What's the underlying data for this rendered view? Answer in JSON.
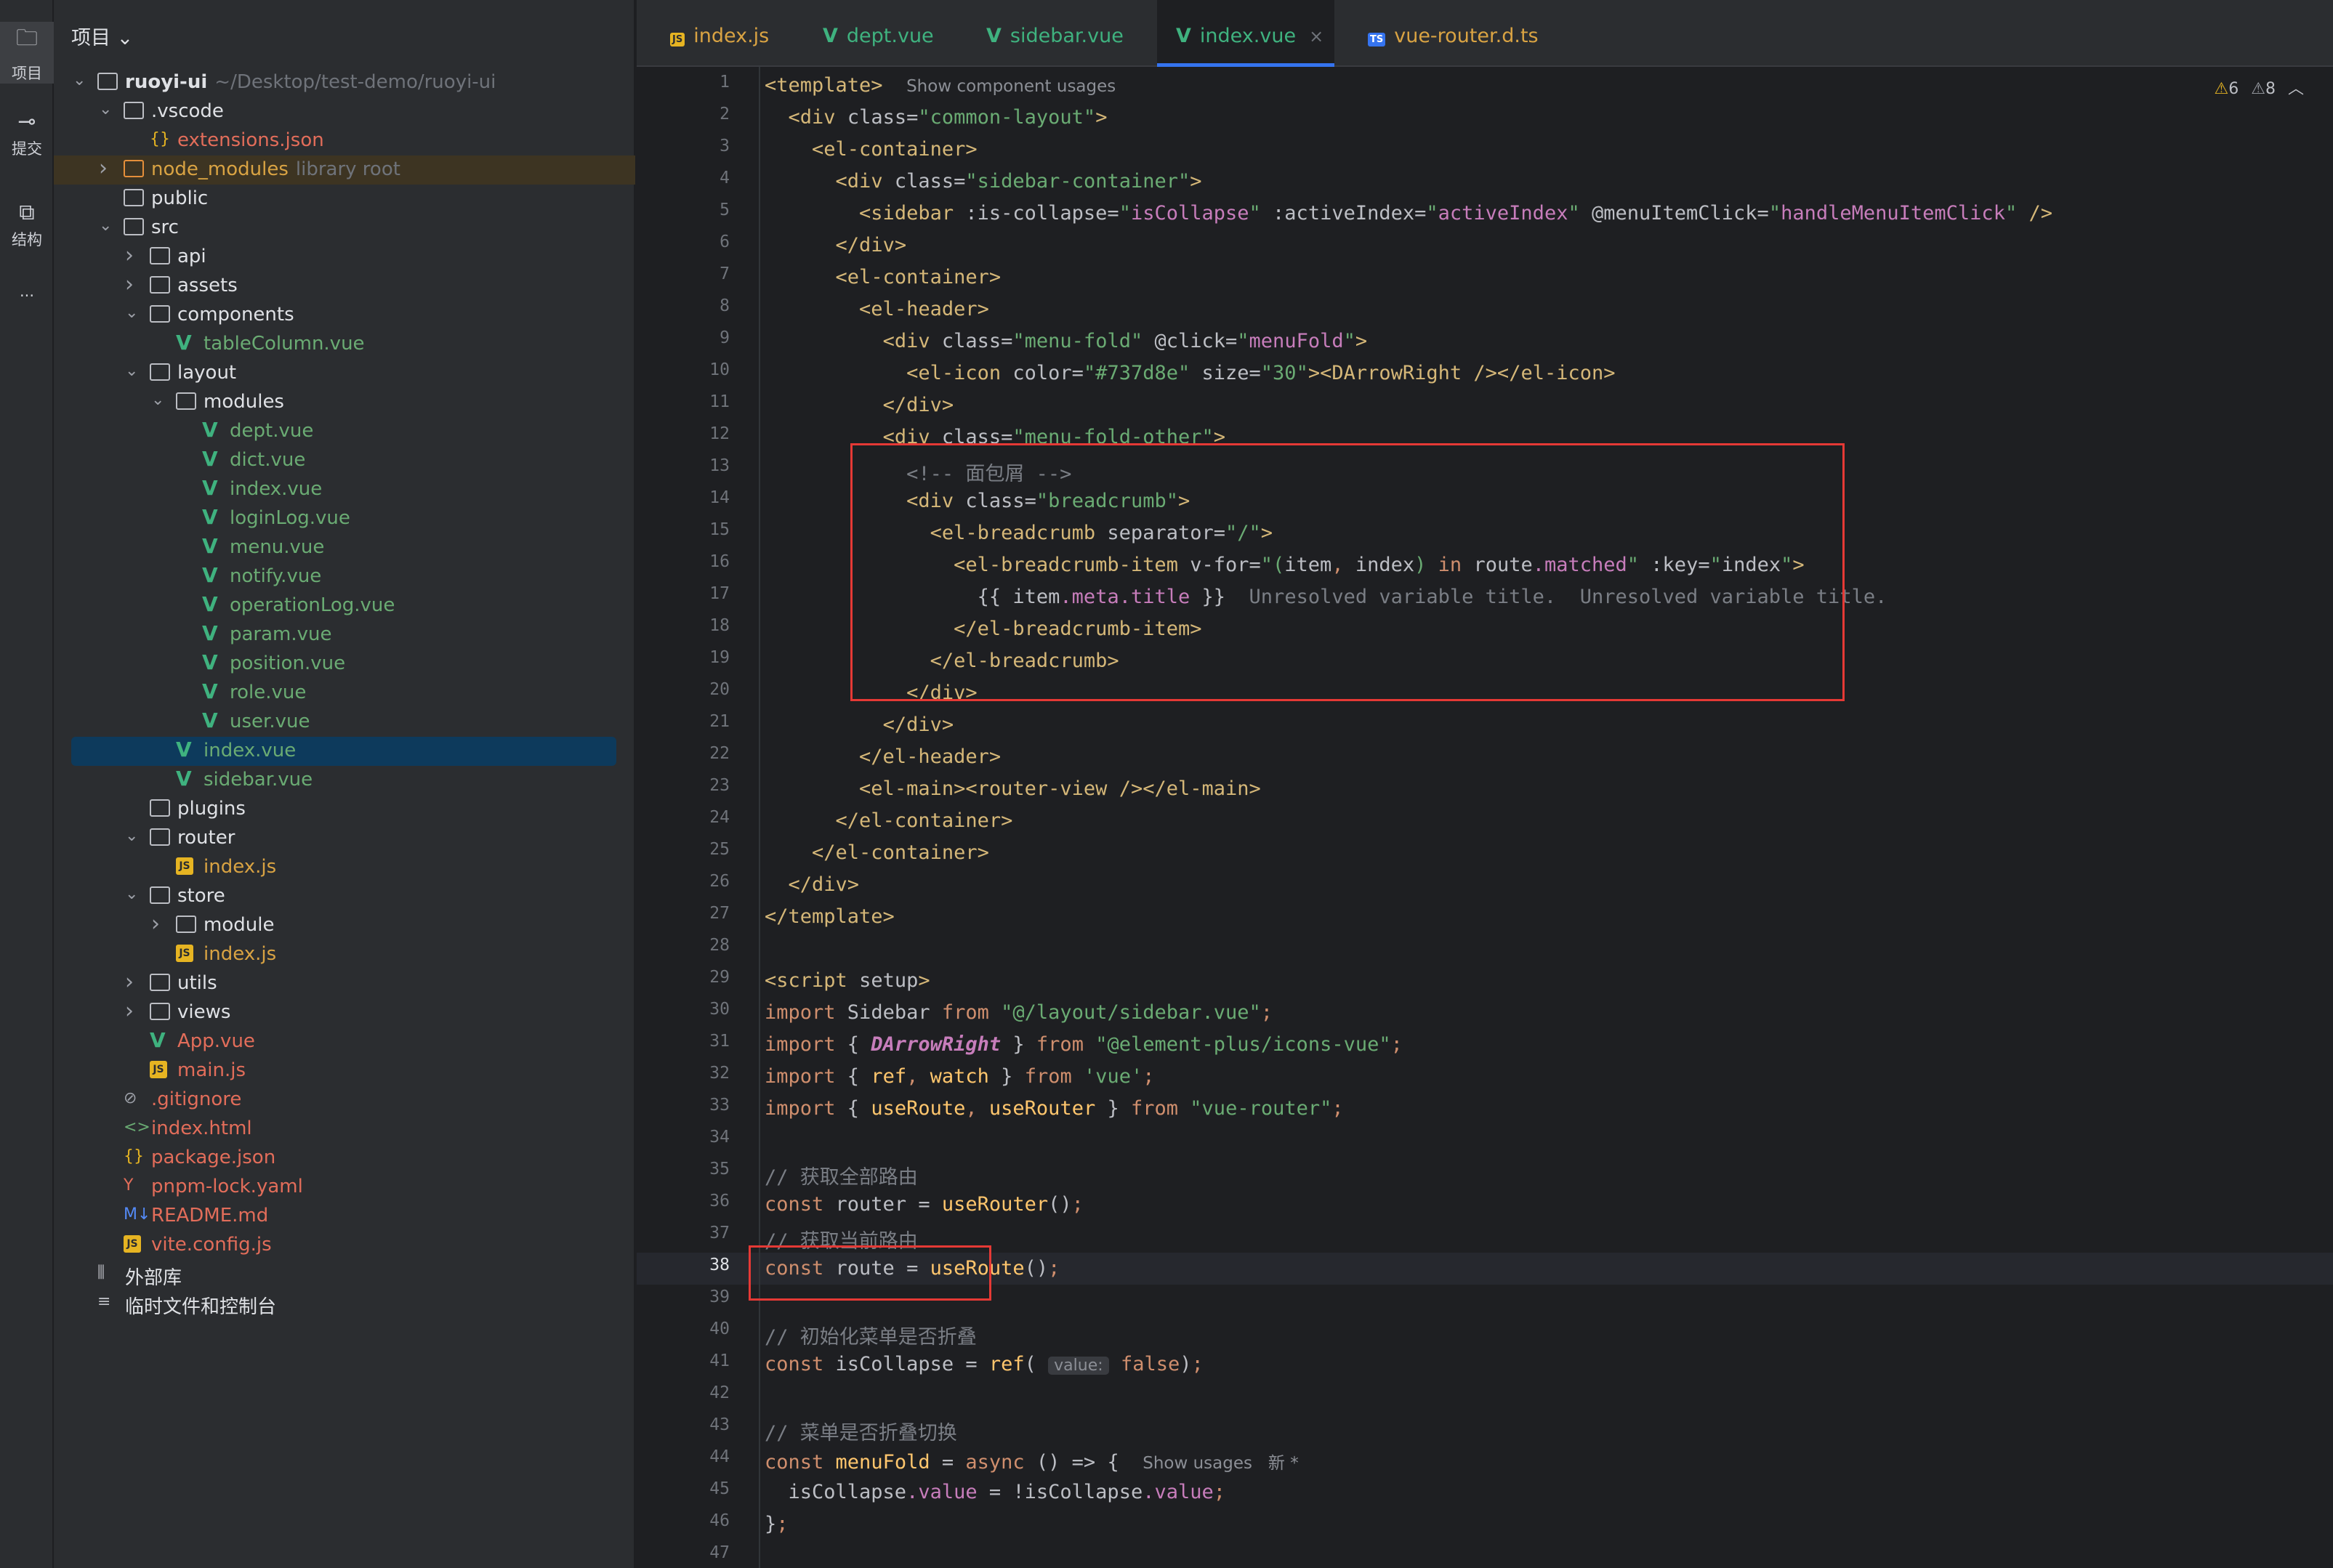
{
  "toolstrip": [
    {
      "label": "项目",
      "icon": "folder-icon"
    },
    {
      "label": "提交",
      "icon": "commit-icon"
    },
    {
      "label": "结构",
      "icon": "structure-icon"
    },
    {
      "label": "···",
      "icon": "more-icon"
    }
  ],
  "project": {
    "title": "项目",
    "tree": [
      {
        "label": "ruoyi-ui",
        "hint": "~/Desktop/test-demo/ruoyi-ui",
        "depth": 0,
        "arrow": "down",
        "icon": "folder",
        "color": "#dfe1e5",
        "bold": true
      },
      {
        "label": ".vscode",
        "depth": 1,
        "arrow": "down",
        "icon": "folder",
        "color": "#dfe1e5"
      },
      {
        "label": "extensions.json",
        "depth": 2,
        "icon": "json",
        "color": "#e26d5a"
      },
      {
        "label": "node_modules",
        "hint": "library root",
        "depth": 1,
        "arrow": "right",
        "icon": "folder-orange",
        "color": "#d9a343",
        "highlight": true
      },
      {
        "label": "public",
        "depth": 1,
        "icon": "folder",
        "color": "#dfe1e5"
      },
      {
        "label": "src",
        "depth": 1,
        "arrow": "down",
        "icon": "folder",
        "color": "#dfe1e5"
      },
      {
        "label": "api",
        "depth": 2,
        "arrow": "right",
        "icon": "folder",
        "color": "#dfe1e5"
      },
      {
        "label": "assets",
        "depth": 2,
        "arrow": "right",
        "icon": "folder",
        "color": "#dfe1e5"
      },
      {
        "label": "components",
        "depth": 2,
        "arrow": "down",
        "icon": "folder",
        "color": "#dfe1e5"
      },
      {
        "label": "tableColumn.vue",
        "depth": 3,
        "icon": "vue",
        "color": "#6aab73"
      },
      {
        "label": "layout",
        "depth": 2,
        "arrow": "down",
        "icon": "folder",
        "color": "#dfe1e5"
      },
      {
        "label": "modules",
        "depth": 3,
        "arrow": "down",
        "icon": "folder",
        "color": "#dfe1e5"
      },
      {
        "label": "dept.vue",
        "depth": 4,
        "icon": "vue",
        "color": "#6aab73"
      },
      {
        "label": "dict.vue",
        "depth": 4,
        "icon": "vue",
        "color": "#6aab73"
      },
      {
        "label": "index.vue",
        "depth": 4,
        "icon": "vue",
        "color": "#6aab73"
      },
      {
        "label": "loginLog.vue",
        "depth": 4,
        "icon": "vue",
        "color": "#6aab73"
      },
      {
        "label": "menu.vue",
        "depth": 4,
        "icon": "vue",
        "color": "#6aab73"
      },
      {
        "label": "notify.vue",
        "depth": 4,
        "icon": "vue",
        "color": "#6aab73"
      },
      {
        "label": "operationLog.vue",
        "depth": 4,
        "icon": "vue",
        "color": "#6aab73"
      },
      {
        "label": "param.vue",
        "depth": 4,
        "icon": "vue",
        "color": "#6aab73"
      },
      {
        "label": "position.vue",
        "depth": 4,
        "icon": "vue",
        "color": "#6aab73"
      },
      {
        "label": "role.vue",
        "depth": 4,
        "icon": "vue",
        "color": "#6aab73"
      },
      {
        "label": "user.vue",
        "depth": 4,
        "icon": "vue",
        "color": "#6aab73"
      },
      {
        "label": "index.vue",
        "depth": 3,
        "icon": "vue",
        "color": "#6aab73",
        "selected": true
      },
      {
        "label": "sidebar.vue",
        "depth": 3,
        "icon": "vue",
        "color": "#6aab73"
      },
      {
        "label": "plugins",
        "depth": 2,
        "icon": "folder",
        "color": "#dfe1e5"
      },
      {
        "label": "router",
        "depth": 2,
        "arrow": "down",
        "icon": "folder",
        "color": "#dfe1e5"
      },
      {
        "label": "index.js",
        "depth": 3,
        "icon": "js",
        "color": "#d9a343"
      },
      {
        "label": "store",
        "depth": 2,
        "arrow": "down",
        "icon": "folder",
        "color": "#dfe1e5"
      },
      {
        "label": "module",
        "depth": 3,
        "arrow": "right",
        "icon": "folder",
        "color": "#dfe1e5"
      },
      {
        "label": "index.js",
        "depth": 3,
        "icon": "js",
        "color": "#d9a343"
      },
      {
        "label": "utils",
        "depth": 2,
        "arrow": "right",
        "icon": "folder",
        "color": "#dfe1e5"
      },
      {
        "label": "views",
        "depth": 2,
        "arrow": "right",
        "icon": "folder",
        "color": "#dfe1e5"
      },
      {
        "label": "App.vue",
        "depth": 2,
        "icon": "vue",
        "color": "#e26d5a"
      },
      {
        "label": "main.js",
        "depth": 2,
        "icon": "js",
        "color": "#e26d5a"
      },
      {
        "label": ".gitignore",
        "depth": 1,
        "icon": "ignore",
        "color": "#e26d5a"
      },
      {
        "label": "index.html",
        "depth": 1,
        "icon": "html",
        "color": "#e26d5a"
      },
      {
        "label": "package.json",
        "depth": 1,
        "icon": "json",
        "color": "#e26d5a"
      },
      {
        "label": "pnpm-lock.yaml",
        "depth": 1,
        "icon": "yaml",
        "color": "#e26d5a"
      },
      {
        "label": "README.md",
        "depth": 1,
        "icon": "md",
        "color": "#e26d5a"
      },
      {
        "label": "vite.config.js",
        "depth": 1,
        "icon": "js",
        "color": "#e26d5a"
      },
      {
        "label": "外部库",
        "depth": 0,
        "icon": "library",
        "color": "#dfe1e5"
      },
      {
        "label": "临时文件和控制台",
        "depth": 0,
        "icon": "scratch",
        "color": "#dfe1e5"
      }
    ]
  },
  "tabs": [
    {
      "label": "index.js",
      "icon": "js",
      "color": "#d9a343"
    },
    {
      "label": "dept.vue",
      "icon": "vue",
      "color": "#3fb27f"
    },
    {
      "label": "sidebar.vue",
      "icon": "vue",
      "color": "#3fb27f"
    },
    {
      "label": "index.vue",
      "icon": "vue",
      "color": "#3fb27f",
      "active": true
    },
    {
      "label": "vue-router.d.ts",
      "icon": "ts",
      "color": "#d9a343"
    }
  ],
  "inspections": {
    "warnings": "6",
    "weak_warnings": "8"
  },
  "current_line": 38,
  "code_lines": [
    "<span class='tg'>&lt;template&gt;</span>  <span class='hint-inline'>Show component usages</span>",
    "  <span class='tg'>&lt;div</span> <span class='at'>class=</span><span class='sv'>\"common-layout\"</span><span class='tg'>&gt;</span>",
    "    <span class='tg'>&lt;el-container&gt;</span>",
    "      <span class='tg'>&lt;div</span> <span class='at'>class=</span><span class='sv'>\"sidebar-container\"</span><span class='tg'>&gt;</span>",
    "        <span class='tg'>&lt;sidebar</span> <span class='at'>:is-collapse=</span><span class='sv'>\"</span><span class='pr'>isCollapse</span><span class='sv'>\"</span> <span class='at'>:activeIndex=</span><span class='sv'>\"</span><span class='pr'>activeIndex</span><span class='sv'>\"</span> <span class='at'>@menuItemClick=</span><span class='sv'>\"</span><span class='pr'>handleMenuItemClick</span><span class='sv'>\"</span> <span class='tg'>/&gt;</span>",
    "      <span class='tg'>&lt;/div&gt;</span>",
    "      <span class='tg'>&lt;el-container&gt;</span>",
    "        <span class='tg'>&lt;el-header&gt;</span>",
    "          <span class='tg'>&lt;div</span> <span class='at'>class=</span><span class='sv'>\"menu-fold\"</span> <span class='at'>@click=</span><span class='sv'>\"</span><span class='pr'>menuFold</span><span class='sv'>\"</span><span class='tg'>&gt;</span>",
    "            <span class='tg'>&lt;el-icon</span> <span class='at'>color=</span><span class='sv'>\"#737d8e\"</span> <span class='at'>size=</span><span class='sv'>\"30\"</span><span class='tg'>&gt;&lt;DArrowRight</span> <span class='tg'>/&gt;&lt;/el-icon&gt;</span>",
    "          <span class='tg'>&lt;/div&gt;</span>",
    "          <span class='tg'>&lt;div</span> <span class='at'>class=</span><span class='sv'>\"menu-fold-other\"</span><span class='tg'>&gt;</span>",
    "            <span class='cm'>&lt;!-- 面包屑 --&gt;</span>",
    "            <span class='tg'>&lt;div</span> <span class='at'>class=</span><span class='sv'>\"breadcrumb\"</span><span class='tg'>&gt;</span>",
    "              <span class='tg'>&lt;el-breadcrumb</span> <span class='at'>separator=</span><span class='sv'>\"/\"</span><span class='tg'>&gt;</span>",
    "                <span class='tg'>&lt;el-breadcrumb-item</span> <span class='at'>v-for=</span><span class='sv'>\"(</span><span class='at'>item</span><span class='kw'>,</span> <span class='at'>index</span><span class='sv'>)</span> <span class='kw'>in</span> <span class='at'>route</span><span class='pr'>.matched</span><span class='sv'>\"</span> <span class='at'>:key=</span><span class='sv'>\"</span><span class='at'>index</span><span class='sv'>\"</span><span class='tg'>&gt;</span>",
    "                  <span class='at'>{{</span> <span class='at'>item</span><span class='pr'>.meta</span><span class='pr'>.title</span> <span class='at'>}}</span>  <span class='cm'>Unresolved variable title.  Unresolved variable title.</span>",
    "                <span class='tg'>&lt;/el-breadcrumb-item&gt;</span>",
    "              <span class='tg'>&lt;/el-breadcrumb&gt;</span>",
    "            <span class='tg'>&lt;/div&gt;</span>",
    "          <span class='tg'>&lt;/div&gt;</span>",
    "        <span class='tg'>&lt;/el-header&gt;</span>",
    "        <span class='tg'>&lt;el-main&gt;&lt;router-view</span> <span class='tg'>/&gt;&lt;/el-main&gt;</span>",
    "      <span class='tg'>&lt;/el-container&gt;</span>",
    "    <span class='tg'>&lt;/el-container&gt;</span>",
    "  <span class='tg'>&lt;/div&gt;</span>",
    "<span class='tg'>&lt;/template&gt;</span>",
    "",
    "<span class='tg'>&lt;script</span> <span class='at'>setup</span><span class='tg'>&gt;</span>",
    "<span class='kw'>import</span> Sidebar <span class='kw'>from</span> <span class='sv'>\"@/layout/sidebar.vue\"</span><span class='kw'>;</span>",
    "<span class='kw'>import</span> { <span class='it'>DArrowRight</span> } <span class='kw'>from</span> <span class='sv'>\"@element-plus/icons-vue\"</span><span class='kw'>;</span>",
    "<span class='kw'>import</span> { <span class='hl'>ref</span><span class='kw'>,</span> <span class='hl'>watch</span> } <span class='kw'>from</span> <span class='sv'>'vue'</span><span class='kw'>;</span>",
    "<span class='kw'>import</span> { <span class='hl'>useRoute</span><span class='kw'>,</span> <span class='hl'>useRouter</span> } <span class='kw'>from</span> <span class='sv'>\"vue-router\"</span><span class='kw'>;</span>",
    "",
    "<span class='cm'>// 获取全部路由</span>",
    "<span class='kw'>const</span> router = <span class='hl'>useRouter</span>()<span class='kw'>;</span>",
    "<span class='cm'>// 获取当前路由</span>",
    "<span class='kw'>const</span> route = <span class='hl'>useRoute</span>()<span class='kw'>;</span>",
    "",
    "<span class='cm'>// 初始化菜单是否折叠</span>",
    "<span class='kw'>const</span> isCollapse = <span class='hl'>ref</span>( <span class='inlay'>value:</span> <span class='kw'>false</span>)<span class='kw'>;</span>",
    "",
    "<span class='cm'>// 菜单是否折叠切换</span>",
    "<span class='kw'>const</span> <span class='hl'>menuFold</span> = <span class='kw'>async</span> () =&gt; {  <span class='hint-inline'>Show usages   新 *</span>",
    "  isCollapse<span class='pr'>.value</span> = !isCollapse<span class='pr'>.value</span><span class='kw'>;</span>",
    "}<span class='kw'>;</span>",
    ""
  ]
}
